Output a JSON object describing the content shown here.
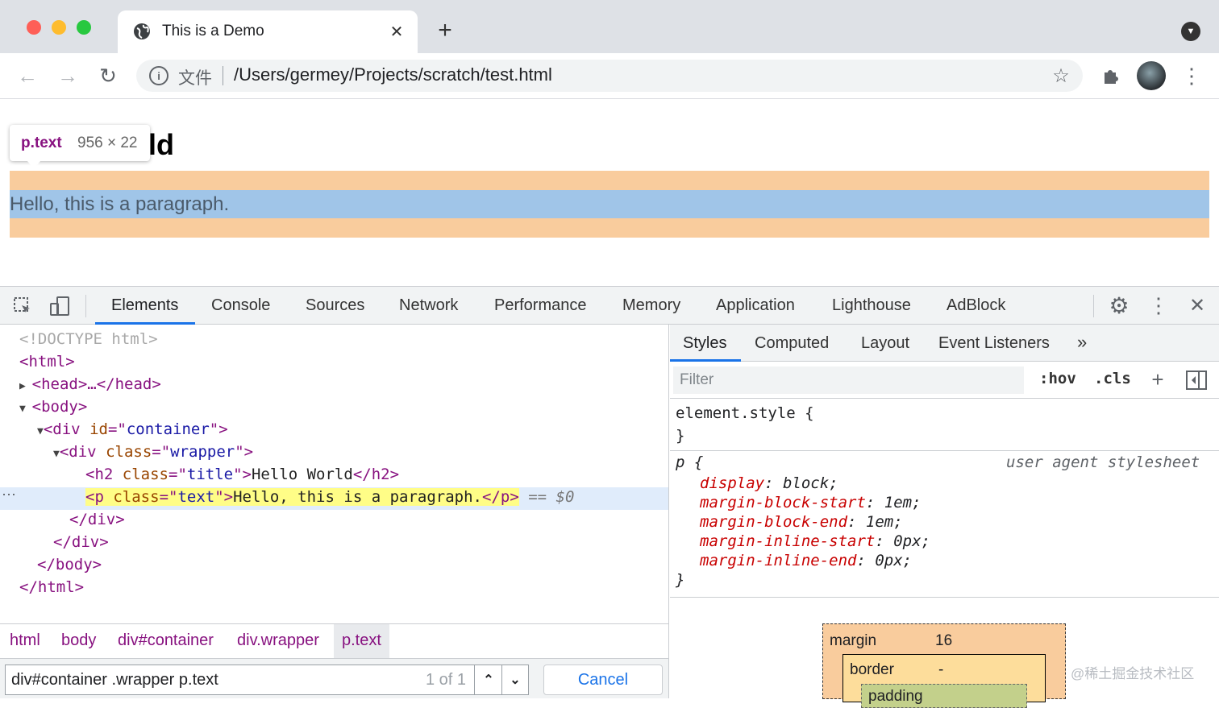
{
  "browser": {
    "tab_title": "This is a Demo",
    "url_prefix": "文件",
    "url": "/Users/germey/Projects/scratch/test.html"
  },
  "page": {
    "heading_visible": "ld",
    "paragraph": "Hello, this is a paragraph.",
    "tooltip_selector": "p.text",
    "tooltip_size": "956 × 22"
  },
  "devtools": {
    "tabs": [
      "Elements",
      "Console",
      "Sources",
      "Network",
      "Performance",
      "Memory",
      "Application",
      "Lighthouse",
      "AdBlock"
    ],
    "dom": {
      "doctype": "<!DOCTYPE html>",
      "html_open": "<html>",
      "head": "<head>…</head>",
      "body_open": "<body>",
      "div_tag": "div",
      "id_attr": "id",
      "id_val": "container",
      "class_attr": "class",
      "wrapper_val": "wrapper",
      "h2_tag": "h2",
      "title_val": "title",
      "h2_text": "Hello World",
      "p_tag": "p",
      "text_val": "text",
      "p_text": "Hello, this is a paragraph.",
      "selected_suffix": "== $0",
      "div_close": "</div>",
      "body_close": "</body>",
      "html_close": "</html>"
    },
    "breadcrumbs": [
      "html",
      "body",
      "div#container",
      "div.wrapper",
      "p.text"
    ],
    "search": {
      "value": "div#container .wrapper p.text",
      "count": "1 of 1",
      "cancel": "Cancel"
    },
    "styles": {
      "tabs": [
        "Styles",
        "Computed",
        "Layout",
        "Event Listeners"
      ],
      "filter_placeholder": "Filter",
      "hov": ":hov",
      "cls": ".cls",
      "element_style": "element.style {",
      "close_brace": "}",
      "selector": "p {",
      "origin": "user agent stylesheet",
      "props": [
        {
          "name": "display",
          "value": "block;"
        },
        {
          "name": "margin-block-start",
          "value": "1em;"
        },
        {
          "name": "margin-block-end",
          "value": "1em;"
        },
        {
          "name": "margin-inline-start",
          "value": "0px;"
        },
        {
          "name": "margin-inline-end",
          "value": "0px;"
        }
      ],
      "boxmodel": {
        "margin_label": "margin",
        "margin_value": "16",
        "border_label": "border",
        "border_value": "-",
        "padding_label": "padding"
      }
    }
  },
  "watermark": "@稀土掘金技术社区",
  "colors": {
    "margin": "#f9cc9d",
    "content": "#a0c5e8",
    "tabbar": "#dee1e6",
    "accent": "#1a73e8"
  }
}
